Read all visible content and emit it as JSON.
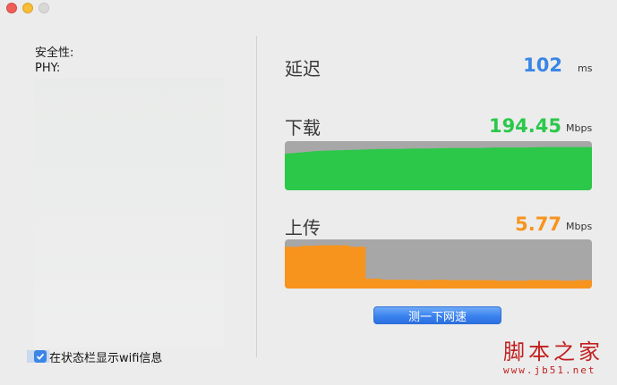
{
  "window": {
    "close": "close",
    "minimize": "minimize",
    "zoom": "zoom"
  },
  "left": {
    "security_label": "安全性:",
    "phy_label": "PHY:",
    "checkbox": {
      "checked": true,
      "label": "在状态栏显示wifi信息"
    }
  },
  "latency": {
    "label": "延迟",
    "value": "102",
    "unit": "ms",
    "color": "#3a86e6"
  },
  "download": {
    "label": "下载",
    "value": "194.45",
    "unit": "Mbps",
    "color": "#2bc84a",
    "history": [
      0.74,
      0.77,
      0.8,
      0.81,
      0.82,
      0.83,
      0.84,
      0.84,
      0.85,
      0.85,
      0.86,
      0.86,
      0.86,
      0.87,
      0.87,
      0.87,
      0.88,
      0.88,
      0.88,
      0.88
    ]
  },
  "upload": {
    "label": "上传",
    "value": "5.77",
    "unit": "Mbps",
    "color": "#f7941d",
    "history": [
      0.85,
      0.87,
      0.88,
      0.88,
      0.85,
      0.2,
      0.18,
      0.18,
      0.17,
      0.18,
      0.17,
      0.17,
      0.17,
      0.16,
      0.16,
      0.17,
      0.17,
      0.16,
      0.17,
      0.16
    ]
  },
  "speed_test_button": "测一下网速",
  "watermark": {
    "title": "脚本之家",
    "url": "www.jb51.net"
  }
}
